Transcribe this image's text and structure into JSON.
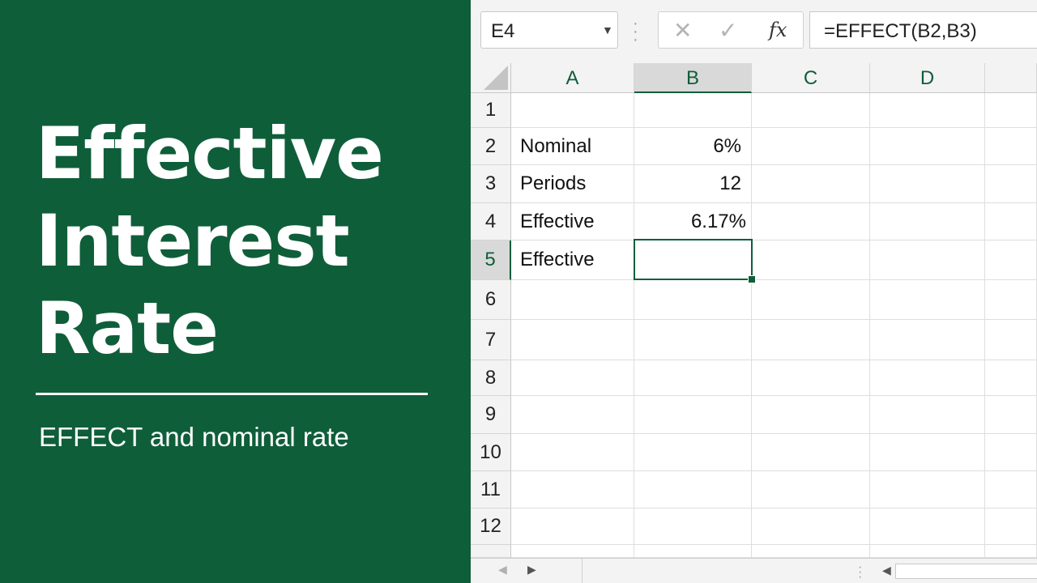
{
  "title": {
    "line1": "Effective",
    "line2": "Interest",
    "line3": "Rate",
    "subtitle": "EFFECT and nominal rate"
  },
  "formula_bar": {
    "name_box": "E4",
    "cancel_icon": "✕",
    "enter_icon": "✓",
    "fx_label": "fx",
    "formula": "=EFFECT(B2,B3)"
  },
  "sheet": {
    "columns": [
      "A",
      "B",
      "C",
      "D"
    ],
    "rows": [
      "1",
      "2",
      "3",
      "4",
      "5",
      "6",
      "7",
      "8",
      "9",
      "10",
      "11",
      "12"
    ],
    "cells": {
      "A2": "Nominal",
      "B2": "6%",
      "A3": "Periods",
      "B3": "12",
      "A4": "Effective",
      "B4": "6.17%",
      "A5": "Effective",
      "B5": ""
    },
    "selected_cell": "B5"
  },
  "colors": {
    "brand_green": "#0f5e3a",
    "header_bg": "#f3f3f3",
    "grid_line": "#dedede"
  },
  "icons": {
    "name_box_dropdown": "chevron-down-icon",
    "cancel": "close-icon",
    "enter": "check-icon",
    "function": "fx-icon",
    "scroll_left": "caret-left-icon",
    "scroll_right": "caret-right-icon"
  }
}
